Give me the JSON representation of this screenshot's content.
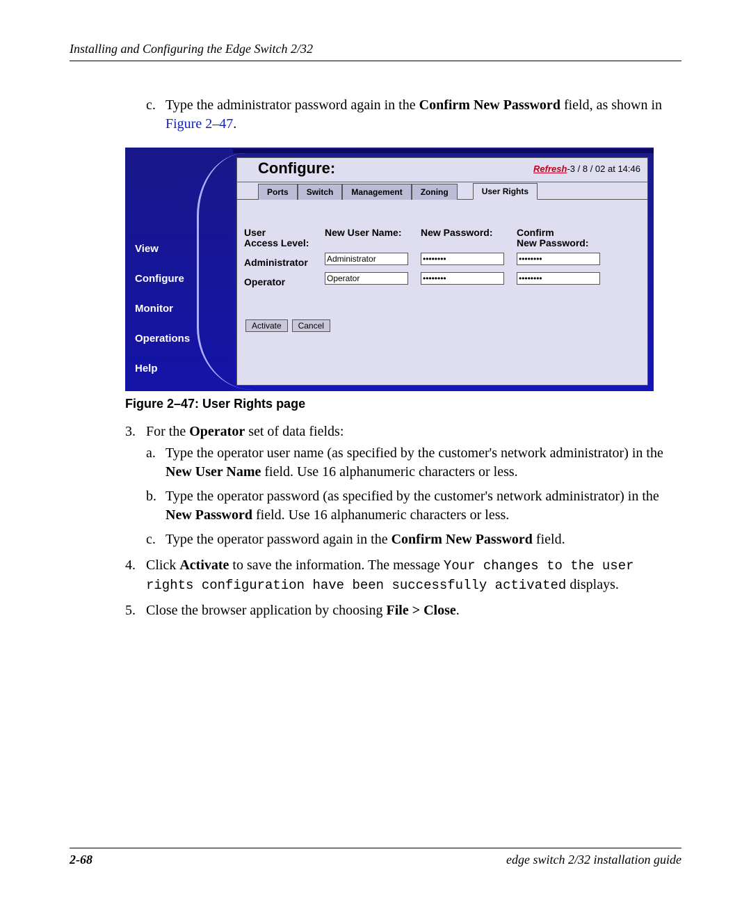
{
  "header": {
    "running_head": "Installing and Configuring the Edge Switch 2/32"
  },
  "text": {
    "item_c_pre": "Type the administrator password again in the ",
    "item_c_bold": "Confirm New Password",
    "item_c_mid": " field, as shown in ",
    "item_c_ref": "Figure 2–47",
    "item_c_post": ".",
    "c_marker": "c.",
    "fig_caption": "Figure 2–47:  User Rights page",
    "s3_marker": "3.",
    "s3_pre": "For the ",
    "s3_bold": "Operator",
    "s3_post": " set of data fields:",
    "s3a_marker": "a.",
    "s3a_pre": "Type the operator user name (as specified by the customer's network administrator) in the ",
    "s3a_bold": "New User Name",
    "s3a_post": " field. Use 16 alphanumeric characters or less.",
    "s3b_marker": "b.",
    "s3b_pre": "Type the operator password (as specified by the customer's network administrator) in the ",
    "s3b_bold": "New Password",
    "s3b_post": " field. Use 16 alphanumeric characters or less.",
    "s3c_marker": "c.",
    "s3c_pre": "Type the operator password again in the ",
    "s3c_bold": "Confirm New Password",
    "s3c_post": " field.",
    "s4_marker": "4.",
    "s4_pre": "Click ",
    "s4_bold": "Activate",
    "s4_mid": " to save the information. The message ",
    "s4_code": "Your changes to the user rights configuration have been successfully activated",
    "s4_post": " displays.",
    "s5_marker": "5.",
    "s5_pre": "Close the browser application by choosing ",
    "s5_bold": "File > Close",
    "s5_post": "."
  },
  "screenshot": {
    "title": "Configure:",
    "refresh_label": "Refresh",
    "refresh_tail": "-3 / 8 / 02 at 14:46",
    "sidebar": [
      "View",
      "Configure",
      "Monitor",
      "Operations",
      "Help"
    ],
    "tabs": [
      "Ports",
      "Switch",
      "Management",
      "Zoning",
      "User Rights"
    ],
    "active_tab_index": 4,
    "columns": {
      "c1": "User\nAccess Level:",
      "c2": "New User Name:",
      "c3": "New Password:",
      "c4": "Confirm\nNew Password:"
    },
    "rows": [
      {
        "level": "Administrator",
        "username": "Administrator",
        "pw": "********",
        "cpw": "********"
      },
      {
        "level": "Operator",
        "username": "Operator",
        "pw": "********",
        "cpw": "********"
      }
    ],
    "buttons": {
      "activate": "Activate",
      "cancel": "Cancel"
    }
  },
  "footer": {
    "page_num": "2-68",
    "book": "edge switch 2/32 installation guide"
  }
}
